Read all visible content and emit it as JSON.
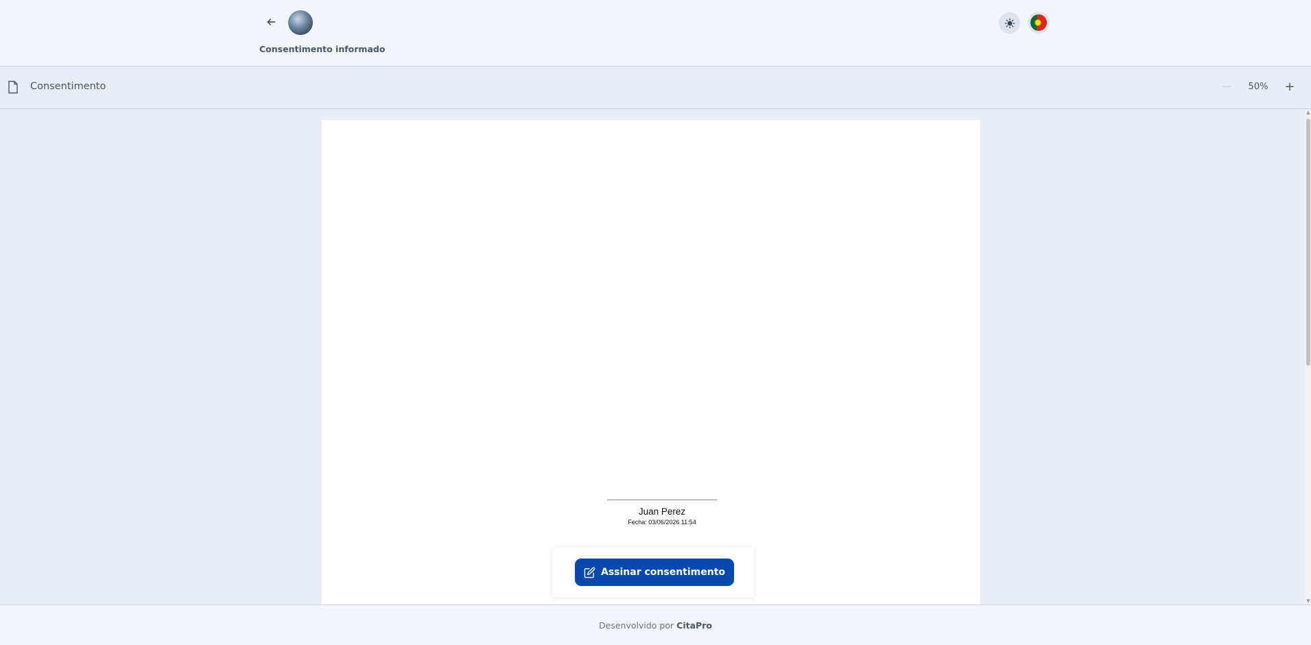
{
  "header": {
    "title": "Consentimento informado",
    "back_icon": "arrow-left-icon",
    "theme_icon": "sun-icon",
    "language_flag": "portugal-flag-icon"
  },
  "toolbar": {
    "document_name": "Consentimento",
    "document_icon": "file-icon",
    "zoom_level": "50%",
    "zoom_out_label": "−",
    "zoom_in_label": "+"
  },
  "document": {
    "signer_name": "Juan Perez",
    "signature_date": "Fecha: 03/06/2026 11:54"
  },
  "actions": {
    "sign_label": "Assinar consentimento",
    "sign_icon": "edit-icon"
  },
  "footer": {
    "prefix": "Desenvolvido por",
    "brand": "CitaPro"
  },
  "colors": {
    "primary": "#0849ad",
    "background": "#e8eef6",
    "header_background": "#f2f6fb"
  }
}
